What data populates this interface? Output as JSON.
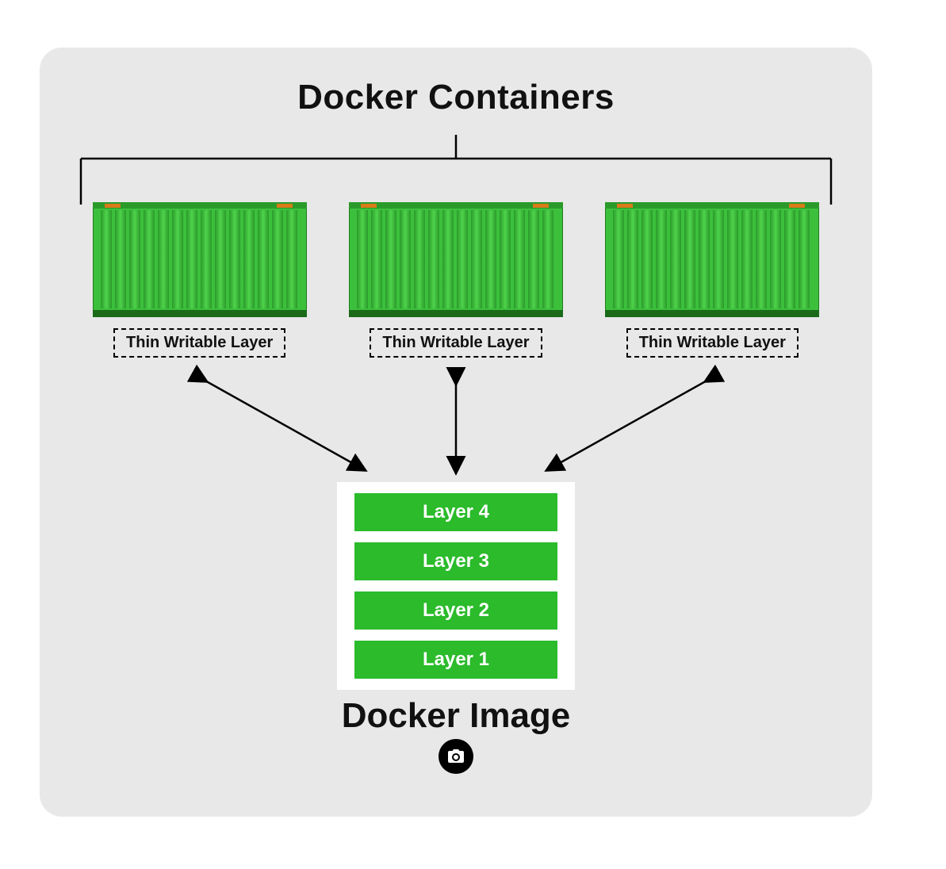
{
  "title_top": "Docker Containers",
  "title_bottom": "Docker Image",
  "containers": [
    {
      "writable_label": "Thin Writable Layer"
    },
    {
      "writable_label": "Thin Writable Layer"
    },
    {
      "writable_label": "Thin Writable Layer"
    }
  ],
  "image_layers": [
    "Layer 4",
    "Layer 3",
    "Layer 2",
    "Layer 1"
  ],
  "colors": {
    "accent_green": "#2bbb2b",
    "container_green_light": "#4fd34b",
    "container_green_dark": "#2a9a2a",
    "canvas_bg": "#e8e8e8"
  }
}
